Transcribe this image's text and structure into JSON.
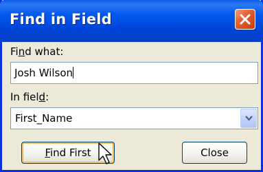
{
  "window": {
    "title": "Find in Field"
  },
  "find_what": {
    "label": "Find what:",
    "label_before": "Fi",
    "label_mnemonic": "n",
    "label_after": "d what:",
    "value": "Josh Wilson"
  },
  "in_field": {
    "label": "In field:",
    "label_before": "In fiel",
    "label_mnemonic": "d",
    "label_after": ":",
    "selected": "First_Name"
  },
  "buttons": {
    "find_first": "Find First",
    "find_first_mnemonic": "F",
    "find_first_rest": "ind First",
    "close": "Close"
  },
  "icons": {
    "close": "close-icon",
    "dropdown": "chevron-down-icon",
    "pointer": "mouse-pointer-icon"
  },
  "colors": {
    "title_bar": "#0058ee",
    "close_button": "#e35c2f",
    "dialog_face": "#ece9d8",
    "field_border": "#7f9db9"
  }
}
